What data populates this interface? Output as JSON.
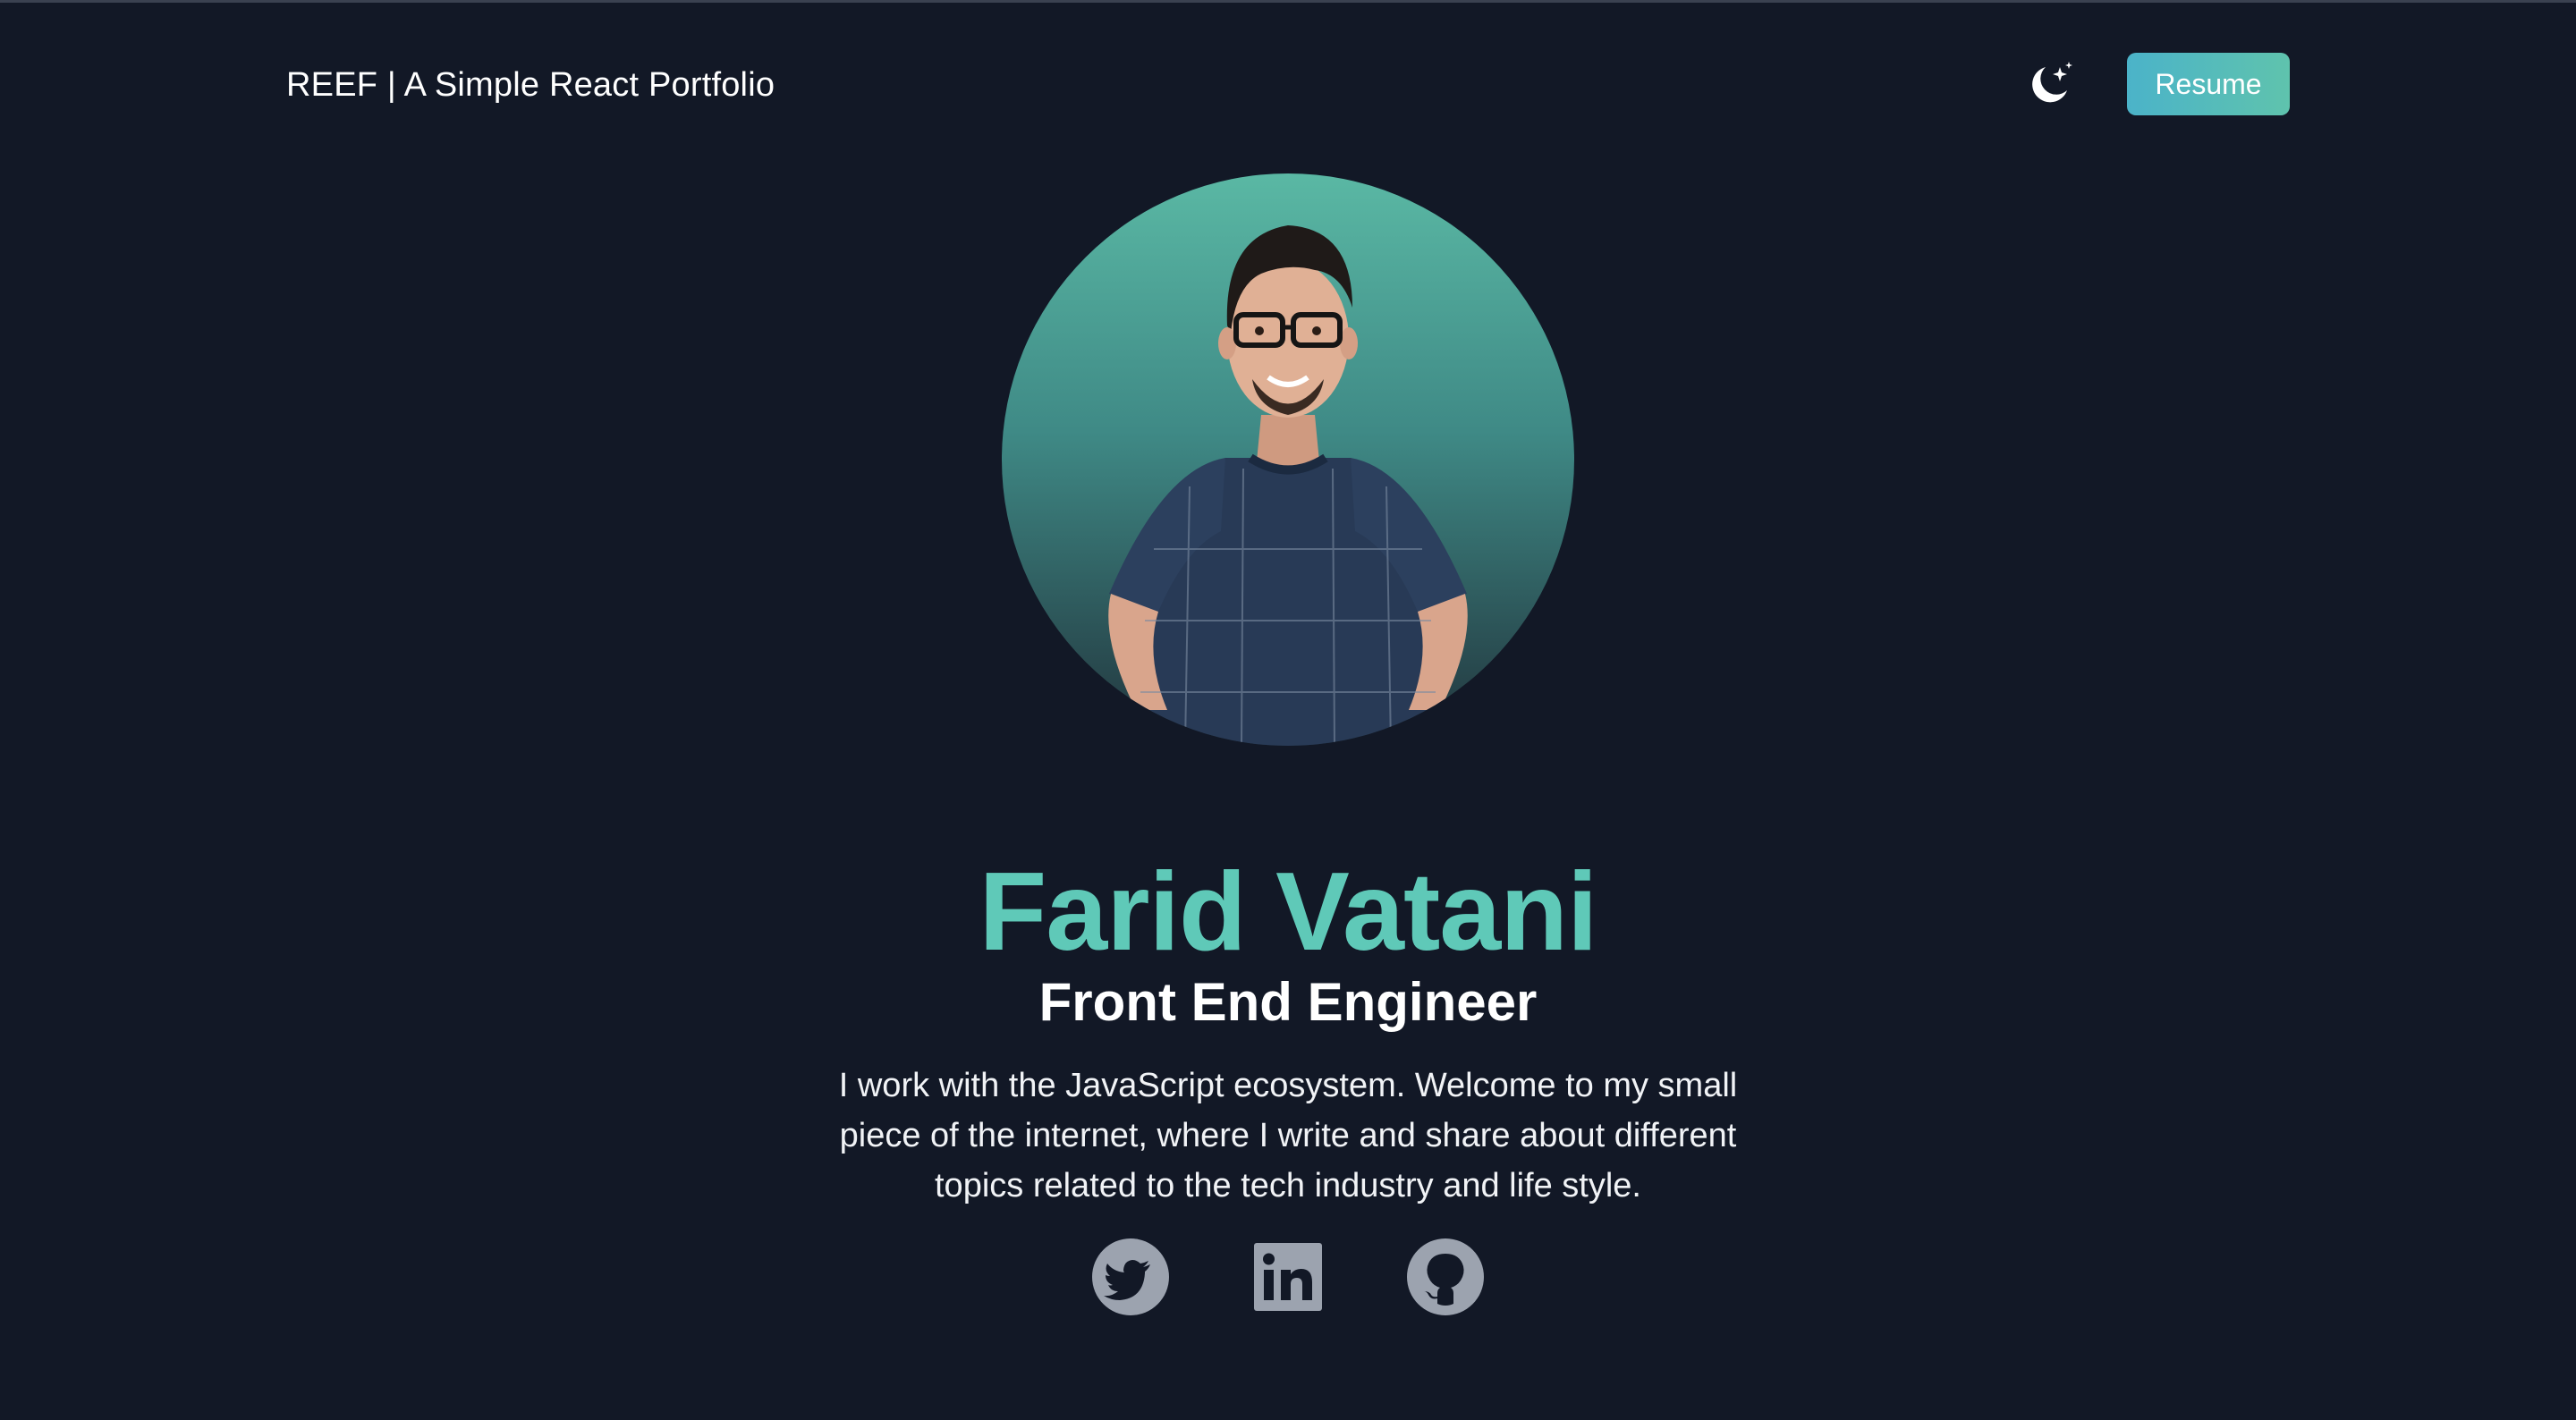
{
  "header": {
    "site_title": "REEF | A Simple React Portfolio",
    "theme_toggle_icon": "moon-stars-icon",
    "resume_label": "Resume"
  },
  "hero": {
    "name": "Farid Vatani",
    "role": "Front End Engineer",
    "bio": "I work with the JavaScript ecosystem. Welcome to my small piece of the internet, where I write and share about different topics related to the tech industry and life style."
  },
  "socials": [
    {
      "icon": "twitter-icon"
    },
    {
      "icon": "linkedin-icon"
    },
    {
      "icon": "github-icon"
    }
  ],
  "colors": {
    "background": "#121826",
    "accent": "#5fc9b8",
    "button_gradient_start": "#4bb3c9",
    "button_gradient_end": "#5fc3ad",
    "icon_gray": "#9ca3af"
  }
}
